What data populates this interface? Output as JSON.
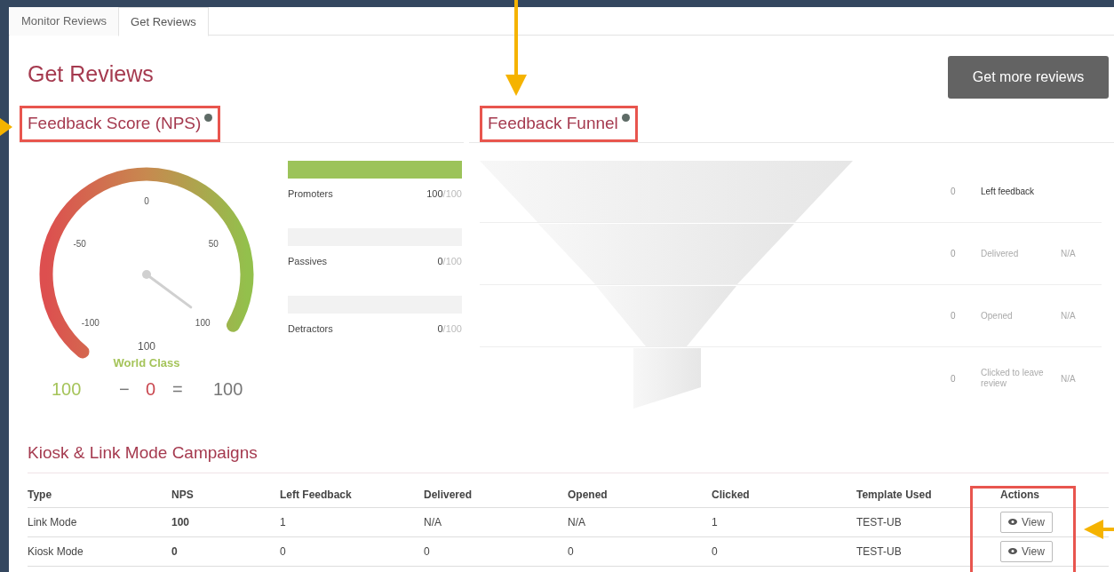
{
  "tabs": [
    {
      "label": "Monitor Reviews",
      "selected": false
    },
    {
      "label": "Get Reviews",
      "selected": true
    }
  ],
  "title": "Get Reviews",
  "primary_button": "Get more reviews",
  "feedback_score": {
    "heading": "Feedback Score (NPS)",
    "gauge": {
      "ticks": [
        "-100",
        "-50",
        "0",
        "50",
        "100"
      ],
      "value": "100",
      "rating": "World Class"
    },
    "formula": {
      "promoters": "100",
      "minus": "−",
      "detractors": "0",
      "equals": "=",
      "result": "100"
    },
    "bars": [
      {
        "label": "Promoters",
        "value": "100",
        "total": "/100",
        "level": 1
      },
      {
        "label": "Passives",
        "value": "0",
        "total": "/100",
        "level": 0
      },
      {
        "label": "Detractors",
        "value": "0",
        "total": "/100",
        "level": 0
      }
    ]
  },
  "feedback_funnel": {
    "heading": "Feedback Funnel",
    "stages": [
      {
        "count": "0",
        "label": "Left feedback",
        "highlighted": true
      },
      {
        "count": "0",
        "label": "Delivered",
        "rate": "N/A",
        "highlighted": false
      },
      {
        "count": "0",
        "label": "Opened",
        "rate": "N/A",
        "highlighted": false
      },
      {
        "count": "0",
        "label": "Clicked to leave review",
        "rate": "N/A",
        "highlighted": false
      }
    ]
  },
  "campaigns": {
    "heading": "Kiosk & Link Mode Campaigns",
    "columns": [
      "Type",
      "NPS",
      "Left Feedback",
      "Delivered",
      "Opened",
      "Clicked",
      "Template Used",
      "Actions"
    ],
    "rows": [
      {
        "cells": [
          "Link Mode",
          "100",
          "1",
          "N/A",
          "N/A",
          "1",
          "TEST-UB"
        ],
        "action": "View"
      },
      {
        "cells": [
          "Kiosk Mode",
          "0",
          "0",
          "0",
          "0",
          "0",
          "TEST-UB"
        ],
        "action": "View"
      }
    ]
  }
}
